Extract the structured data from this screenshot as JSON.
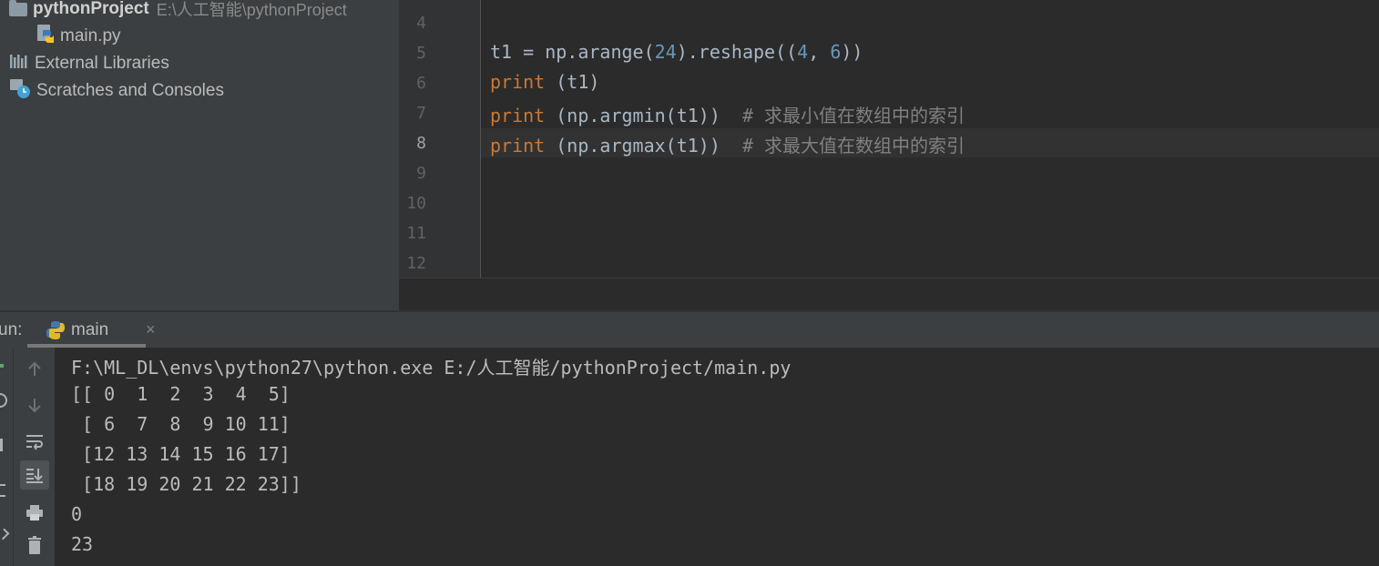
{
  "project_tree": {
    "root_name": "pythonProject",
    "root_path": "E:\\人工智能\\pythonProject",
    "items": [
      {
        "label": "main.py",
        "icon": "python-file-icon"
      },
      {
        "label": "External Libraries",
        "icon": "libraries-icon"
      },
      {
        "label": "Scratches and Consoles",
        "icon": "scratches-icon"
      }
    ]
  },
  "editor": {
    "line_numbers": [
      "4",
      "5",
      "6",
      "7",
      "8",
      "9",
      "10",
      "11",
      "12"
    ],
    "current_line": "8",
    "code": {
      "l5": {
        "a": "t1 = np.arange(",
        "n1": "24",
        "b": ").reshape((",
        "n2": "4",
        "c": ", ",
        "n3": "6",
        "d": "))"
      },
      "l6": {
        "kw": "print",
        "rest": " (t1)"
      },
      "l7": {
        "kw": "print",
        "rest": " (np.argmin(t1))  ",
        "comment": "# 求最小值在数组中的索引"
      },
      "l8": {
        "kw": "print",
        "rest": " (np.argmax(t1))  ",
        "comment": "# 求最大值在数组中的索引"
      }
    }
  },
  "run_panel": {
    "label": "un:",
    "tab_label": "main",
    "close_glyph": "×"
  },
  "console": {
    "lines": [
      "F:\\ML_DL\\envs\\python27\\python.exe E:/人工智能/pythonProject/main.py",
      "[[ 0  1  2  3  4  5]",
      " [ 6  7  8  9 10 11]",
      " [12 13 14 15 16 17]",
      " [18 19 20 21 22 23]]",
      "0",
      "23"
    ]
  },
  "toolbar": {
    "buttons": [
      "up-arrow-icon",
      "down-arrow-icon",
      "soft-wrap-icon",
      "scroll-to-end-icon",
      "print-icon",
      "trash-icon"
    ]
  },
  "colors": {
    "keyword": "#cc7832",
    "number": "#6897bb",
    "comment": "#808080",
    "text": "#a9b7c6",
    "panel_bg": "#3c3f41",
    "editor_bg": "#2b2b2b"
  }
}
